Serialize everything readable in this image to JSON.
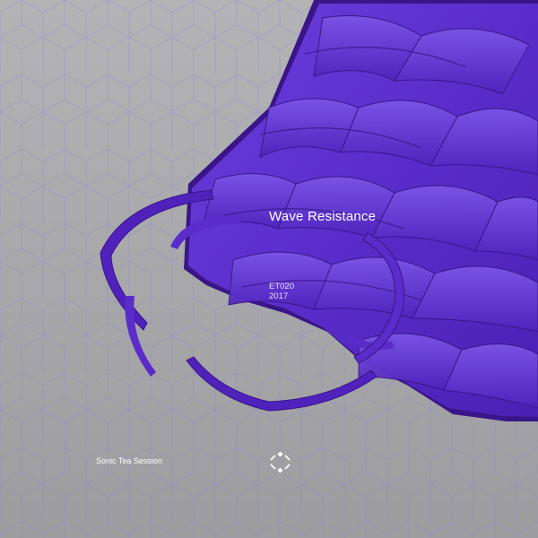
{
  "cover": {
    "title": "Wave Resistance",
    "catalog_number": "ET020",
    "year": "2017",
    "artist": "Sonic Tea Session",
    "logo_icon": "diamond-frame-icon"
  },
  "colors": {
    "background": "#a9a9ab",
    "grid_lines": "#8b80d6",
    "accent_purple": "#5b2fc9",
    "shadow_purple": "#3a1588",
    "text": "#ffffff"
  }
}
